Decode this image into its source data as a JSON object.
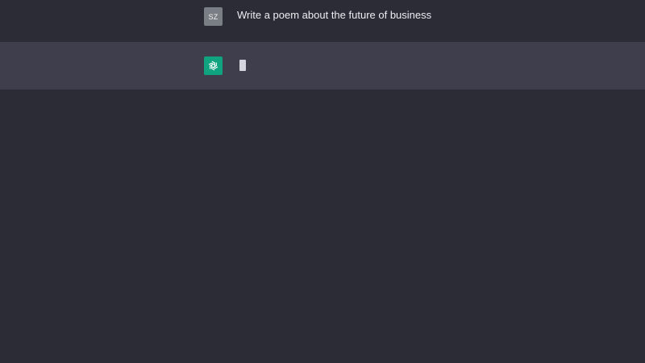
{
  "conversation": {
    "user_message": {
      "avatar_initials": "SZ",
      "text": "Write a poem about the future of business"
    },
    "assistant_message": {
      "avatar_icon": "openai-logo-icon",
      "status": "typing"
    }
  },
  "colors": {
    "background": "#2c2c36",
    "assistant_row": "#3e3e4d",
    "user_avatar": "#7a7e85",
    "assistant_avatar": "#10a37f",
    "text": "#ececf1"
  }
}
